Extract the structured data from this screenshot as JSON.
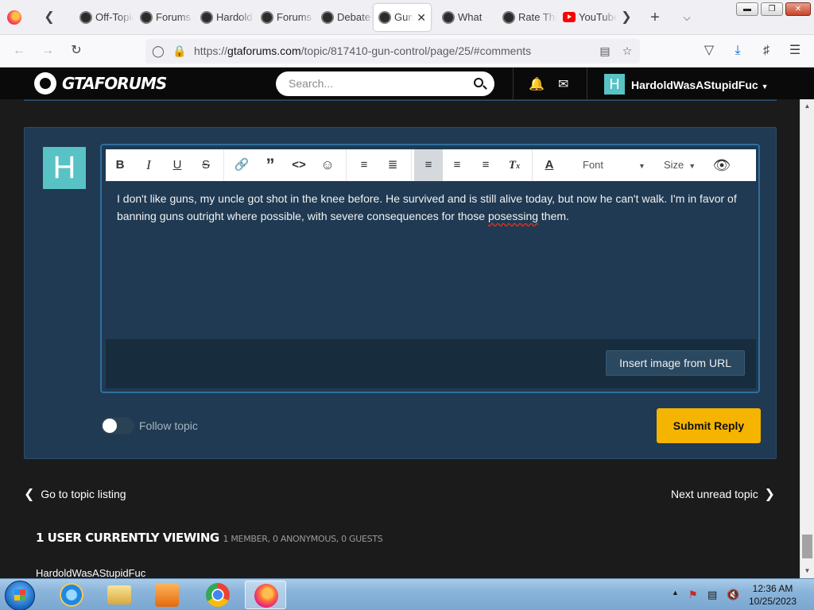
{
  "browser": {
    "tabs": [
      {
        "label": "Off-Topic",
        "icon": "gtaforums-icon",
        "active": false
      },
      {
        "label": "Forums",
        "icon": "gtaforums-icon",
        "active": false
      },
      {
        "label": "Hardold",
        "icon": "gtaforums-icon",
        "active": false
      },
      {
        "label": "Forums",
        "icon": "gtaforums-icon",
        "active": false
      },
      {
        "label": "Debate",
        "icon": "gtaforums-icon",
        "active": false
      },
      {
        "label": "Gun",
        "icon": "gtaforums-icon",
        "active": true
      },
      {
        "label": "What",
        "icon": "gtaforums-icon",
        "active": false
      },
      {
        "label": "Rate This",
        "icon": "gtaforums-icon",
        "active": false
      },
      {
        "label": "YouTube",
        "icon": "youtube-icon",
        "active": false
      }
    ],
    "url_prefix": "https://",
    "url_host": "gtaforums.com",
    "url_path": "/topic/817410-gun-control/page/25/#comments"
  },
  "site": {
    "logo_text": "GTAFORUMS",
    "search_placeholder": "Search...",
    "user_initial": "H",
    "user_name": "HardoldWasAStupidFuc"
  },
  "editor": {
    "avatar_initial": "H",
    "toolbar": {
      "font_label": "Font",
      "size_label": "Size"
    },
    "text_before": "I don't like guns, my uncle got shot in the knee before. He survived and is still alive today, but now he can't walk. I'm in favor of banning guns outright where possible, with severe consequences for those ",
    "text_misspelled": "posessing",
    "text_after": " them.",
    "insert_image_label": "Insert image from URL"
  },
  "reply": {
    "follow_label": "Follow topic",
    "submit_label": "Submit Reply"
  },
  "pagination": {
    "prev_label": "Go to topic listing",
    "next_label": "Next unread topic"
  },
  "viewing": {
    "title": "1 USER CURRENTLY VIEWING",
    "subtitle": "1 MEMBER, 0 ANONYMOUS, 0 GUESTS",
    "users": [
      "HardoldWasAStupidFuc"
    ]
  },
  "taskbar": {
    "time": "12:36 AM",
    "date": "10/25/2023"
  },
  "colors": {
    "accent_yellow": "#f5b400",
    "panel_blue": "#1f3a52",
    "avatar_teal": "#58c2c4"
  }
}
